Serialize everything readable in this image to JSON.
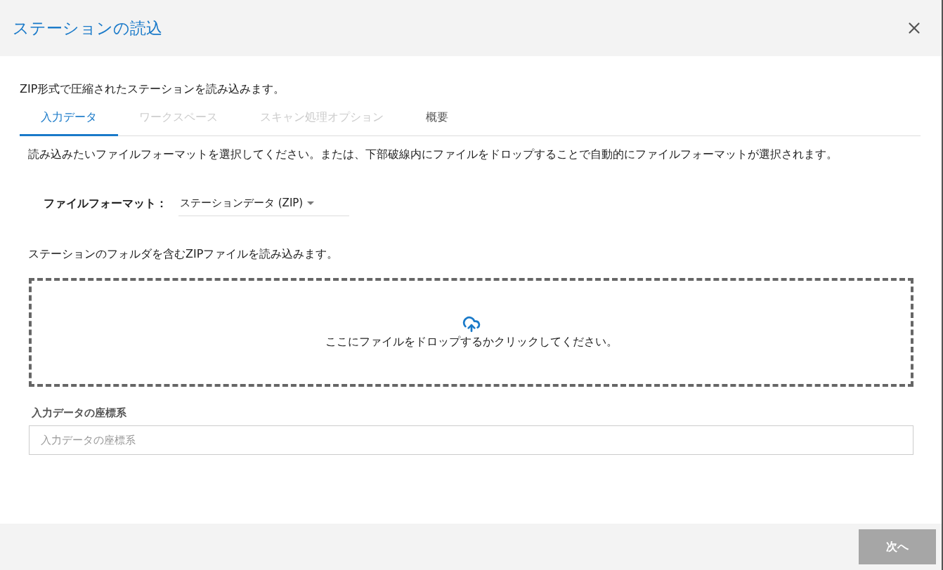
{
  "dialog": {
    "title": "ステーションの読込"
  },
  "intro": "ZIP形式で圧縮されたステーションを読み込みます。",
  "tabs": [
    {
      "label": "入力データ",
      "selected": true,
      "disabled": false
    },
    {
      "label": "ワークスペース",
      "selected": false,
      "disabled": true
    },
    {
      "label": "スキャン処理オプション",
      "selected": false,
      "disabled": true
    },
    {
      "label": "概要",
      "selected": false,
      "disabled": false
    }
  ],
  "instructions": "読み込みたいファイルフォーマットを選択してください。または、下部破線内にファイルをドロップすることで自動的にファイルフォーマットが選択されます。",
  "file_format": {
    "label": "ファイルフォーマット：",
    "value": "ステーションデータ (ZIP)"
  },
  "format_note": "ステーションのフォルダを含むZIPファイルを読み込みます。",
  "dropzone": {
    "text": "ここにファイルをドロップするかクリックしてください。"
  },
  "crs": {
    "label": "入力データの座標系",
    "placeholder": "入力データの座標系"
  },
  "footer": {
    "next_button": {
      "label": "次へ",
      "disabled": true
    }
  }
}
